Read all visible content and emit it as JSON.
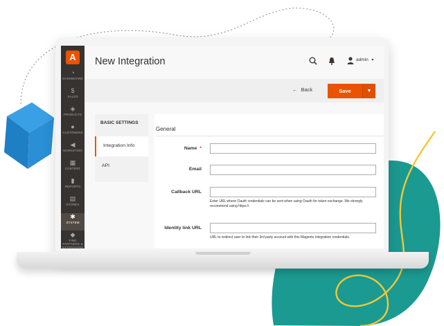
{
  "header": {
    "title": "New Integration",
    "user": "admin"
  },
  "sidebar": {
    "items": [
      {
        "label": "Dashboard",
        "icon": "speedometer-icon"
      },
      {
        "label": "Sales",
        "icon": "dollar-icon"
      },
      {
        "label": "Products",
        "icon": "cube-icon"
      },
      {
        "label": "Customers",
        "icon": "person-icon"
      },
      {
        "label": "Marketing",
        "icon": "megaphone-icon"
      },
      {
        "label": "Content",
        "icon": "layout-icon"
      },
      {
        "label": "Reports",
        "icon": "bar-chart-icon"
      },
      {
        "label": "Stores",
        "icon": "storefront-icon"
      },
      {
        "label": "System",
        "icon": "gear-icon"
      },
      {
        "label": "Find Partners & Extensions",
        "icon": "puzzle-icon"
      }
    ]
  },
  "actions": {
    "back_label": "Back",
    "save_label": "Save"
  },
  "tabs": {
    "title": "BASIC SETTINGS",
    "items": [
      "Integration Info",
      "API"
    ]
  },
  "form": {
    "section_title": "General",
    "name_label": "Name",
    "email_label": "Email",
    "callback_label": "Callback URL",
    "callback_note": "Enter URL where Oauth credentials can be sent when using Oauth for token exchange. We strongly recommend using https://.",
    "identity_label": "Identity link URL",
    "identity_note": "URL to redirect user to link their 3rd party account with this Magento integration credentials."
  },
  "colors": {
    "accent": "#eb5202",
    "sidebar": "#373330",
    "teal": "#1b9a91",
    "cube": "#2b8fd6",
    "yellow": "#f5c833"
  }
}
